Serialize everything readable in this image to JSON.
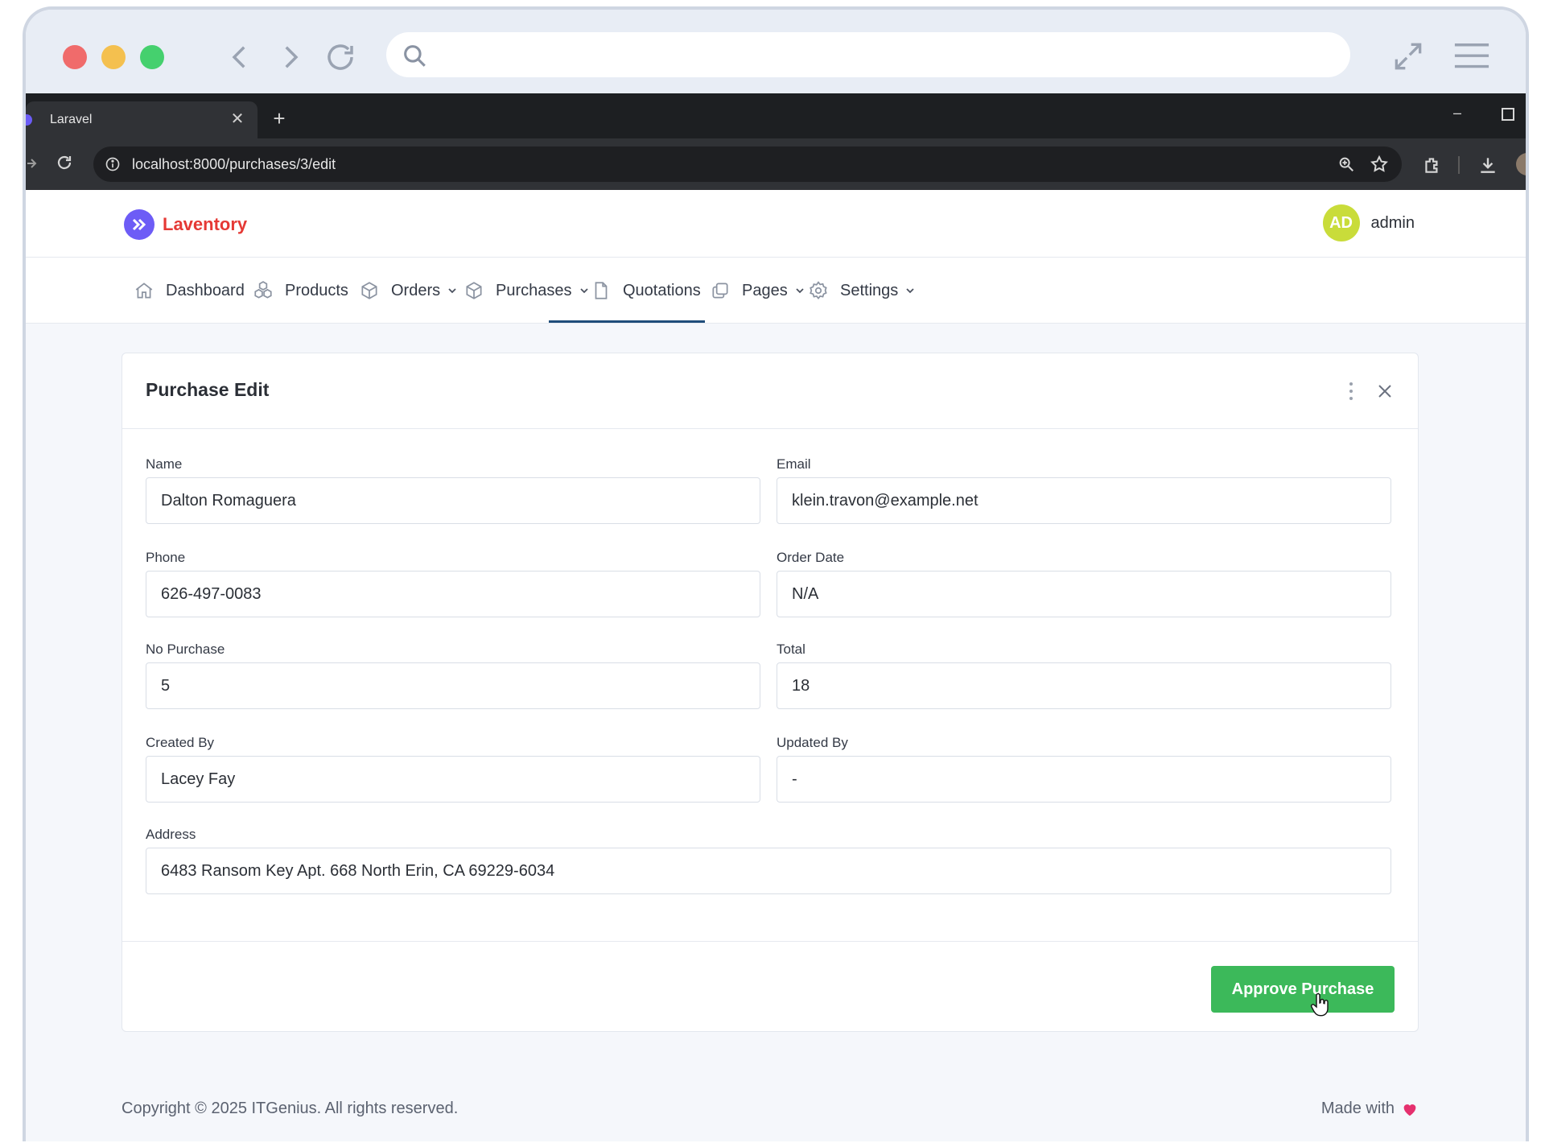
{
  "browser": {
    "tab_title": "Laravel",
    "tab_close": "✕",
    "new_tab": "+",
    "min": "–",
    "url": "localhost:8000/purchases/3/edit"
  },
  "app": {
    "brand": "Laventory",
    "user": {
      "initials": "AD",
      "name": "admin"
    },
    "nav": [
      {
        "label": "Dashboard",
        "icon": "home-icon"
      },
      {
        "label": "Products",
        "icon": "cubes-icon"
      },
      {
        "label": "Orders",
        "icon": "box-icon"
      },
      {
        "label": "Purchases",
        "icon": "box-icon",
        "active": true
      },
      {
        "label": "Quotations",
        "icon": "file-icon"
      },
      {
        "label": "Pages",
        "icon": "copy-icon"
      },
      {
        "label": "Settings",
        "icon": "gear-icon"
      }
    ]
  },
  "form": {
    "title": "Purchase Edit",
    "fields": {
      "name": {
        "label": "Name",
        "value": "Dalton Romaguera"
      },
      "email": {
        "label": "Email",
        "value": "klein.travon@example.net"
      },
      "phone": {
        "label": "Phone",
        "value": "626-497-0083"
      },
      "order_date": {
        "label": "Order Date",
        "value": "N/A"
      },
      "no_purchase": {
        "label": "No Purchase",
        "value": "5"
      },
      "total": {
        "label": "Total",
        "value": "18"
      },
      "created_by": {
        "label": "Created By",
        "value": "Lacey Fay"
      },
      "updated_by": {
        "label": "Updated By",
        "value": "-"
      },
      "address": {
        "label": "Address",
        "value": "6483 Ransom Key Apt. 668 North Erin, CA 69229-6034"
      }
    },
    "approve_label": "Approve Purchase"
  },
  "footer": {
    "copyright": "Copyright © 2025 ITGenius. All rights reserved.",
    "made_with": "Made with"
  },
  "colors": {
    "brand": "#e53935",
    "accent": "#3cb95a",
    "avatar": "#c9dc3a",
    "active_nav": "#1f4d7a"
  }
}
